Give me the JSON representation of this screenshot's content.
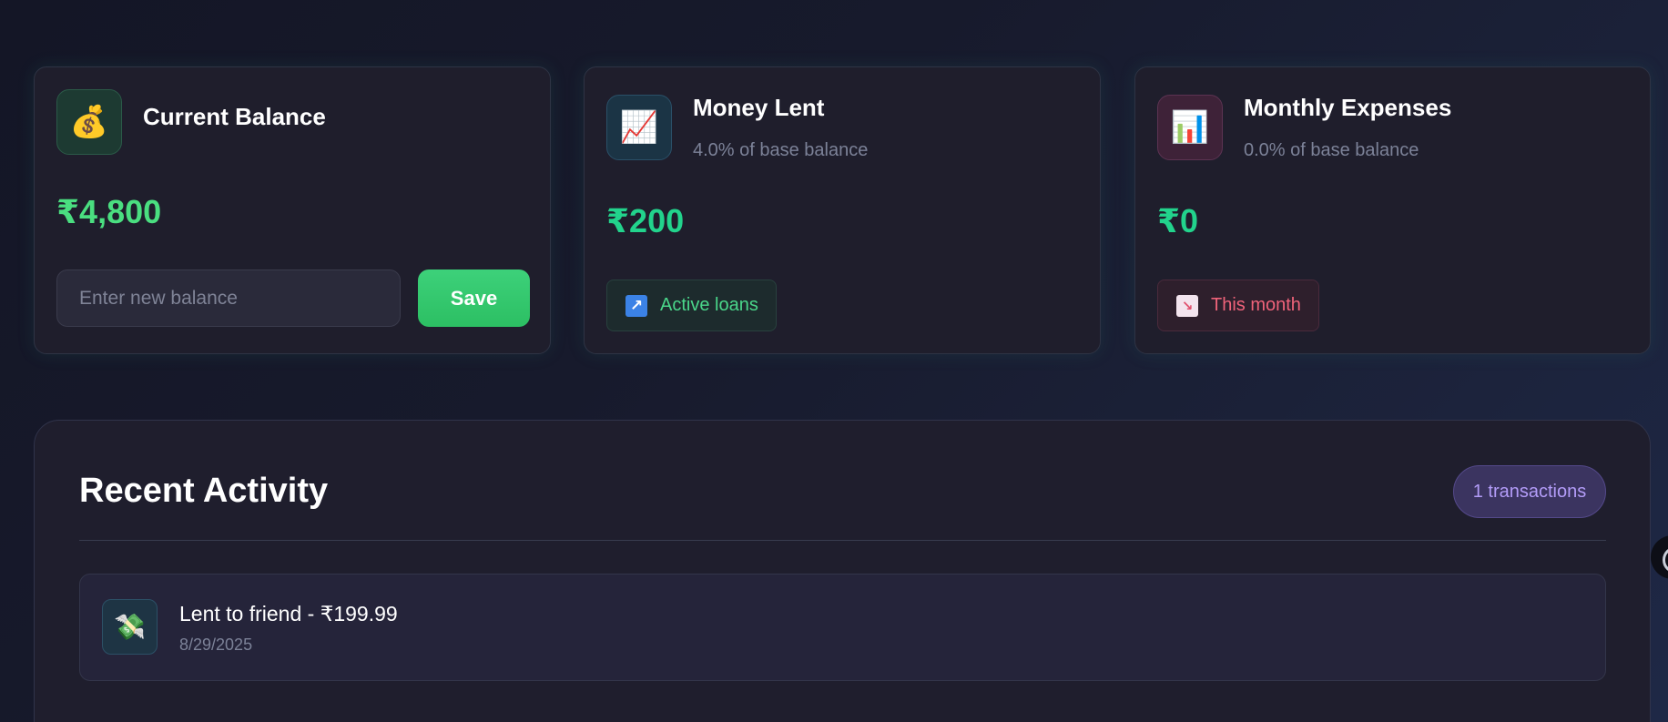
{
  "balance_card": {
    "icon": "money-bag-icon",
    "icon_glyph": "💰",
    "title": "Current Balance",
    "amount": "₹4,800",
    "amount_color": "#4ade80",
    "input_placeholder": "Enter new balance",
    "input_value": "",
    "save_label": "Save"
  },
  "lent_card": {
    "icon": "chart-increasing-icon",
    "icon_glyph": "📈",
    "title": "Money Lent",
    "subtitle": "4.0% of base balance",
    "amount": "₹200",
    "amount_color": "#22d38c",
    "badge_icon": "arrow-up-right-icon",
    "badge_glyph": "↗",
    "badge_label": "Active loans"
  },
  "expenses_card": {
    "icon": "bar-chart-icon",
    "icon_glyph": "📊",
    "title": "Monthly Expenses",
    "subtitle": "0.0% of base balance",
    "amount": "₹0",
    "amount_color": "#22d38c",
    "badge_icon": "chart-decreasing-icon",
    "badge_glyph": "↘",
    "badge_label": "This month"
  },
  "activity": {
    "title": "Recent Activity",
    "count_label": "1 transactions",
    "transactions": [
      {
        "icon": "money-with-wings-icon",
        "icon_glyph": "💸",
        "description": "Lent to friend - ₹199.99",
        "date": "8/29/2025"
      }
    ]
  }
}
